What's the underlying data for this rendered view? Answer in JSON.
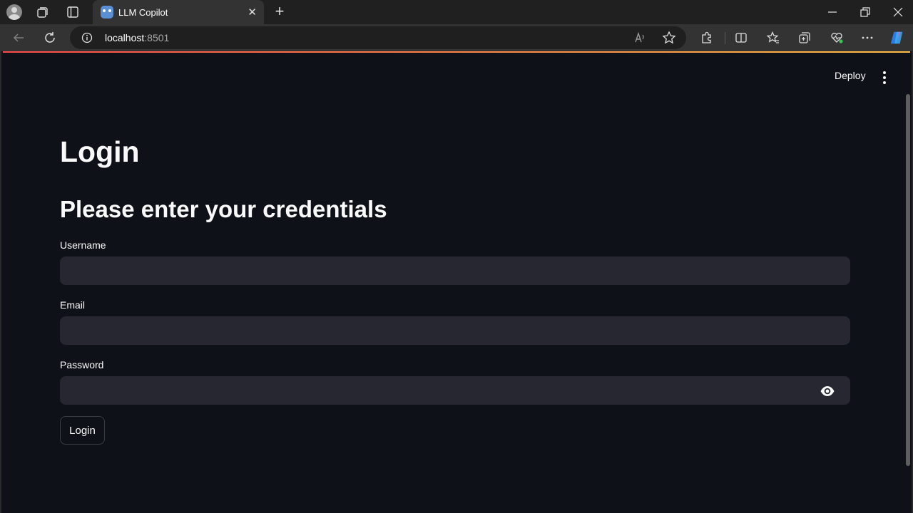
{
  "browser": {
    "tab_title": "LLM Copilot",
    "url_host": "localhost",
    "url_port": ":8501",
    "icons": {
      "profile": "profile-avatar-icon",
      "workspaces": "workspaces-icon",
      "tab_actions": "tab-actions-icon",
      "new_tab": "plus-icon",
      "back": "arrow-left-icon",
      "reload": "reload-icon",
      "site_info": "info-icon",
      "read_aloud": "read-aloud-icon",
      "favorite": "star-icon",
      "extensions": "puzzle-icon",
      "split_screen": "split-screen-icon",
      "favorites": "favorites-icon",
      "collections": "collections-icon",
      "browser_essentials": "heart-pulse-icon",
      "more": "more-horizontal-icon",
      "copilot": "copilot-icon"
    }
  },
  "app": {
    "toolbar": {
      "deploy_label": "Deploy"
    },
    "title": "Login",
    "subtitle": "Please enter your credentials",
    "form": {
      "username_label": "Username",
      "username_value": "",
      "email_label": "Email",
      "email_value": "",
      "password_label": "Password",
      "password_value": "",
      "submit_label": "Login"
    },
    "colors": {
      "background": "#0e1117",
      "input_bg": "#262730",
      "text": "#fafafa",
      "accent_start": "#ff4b4b",
      "accent_end": "#ffbd45"
    }
  }
}
